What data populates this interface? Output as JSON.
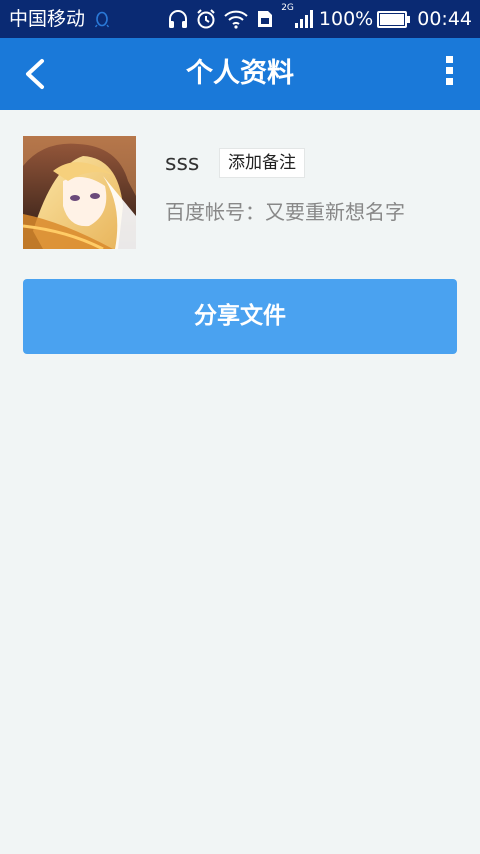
{
  "status_bar": {
    "carrier": "中国移动",
    "network": "2G",
    "battery": "100%",
    "time": "00:44",
    "icons": [
      "qq-icon",
      "headphones-icon",
      "alarm-icon",
      "wifi-icon",
      "sim-icon",
      "signal-icon",
      "battery-icon"
    ]
  },
  "app_bar": {
    "title": "个人资料",
    "back_icon": "chevron-left-icon",
    "more_icon": "more-vertical-icon"
  },
  "profile": {
    "name": "sss",
    "remark_label": "添加备注",
    "account": "百度帐号：又要重新想名字"
  },
  "actions": {
    "share_label": "分享文件"
  },
  "colors": {
    "status_bar": "#0a2a73",
    "app_bar": "#1a79d9",
    "button": "#4aa2f0",
    "background": "#f1f5f5"
  }
}
